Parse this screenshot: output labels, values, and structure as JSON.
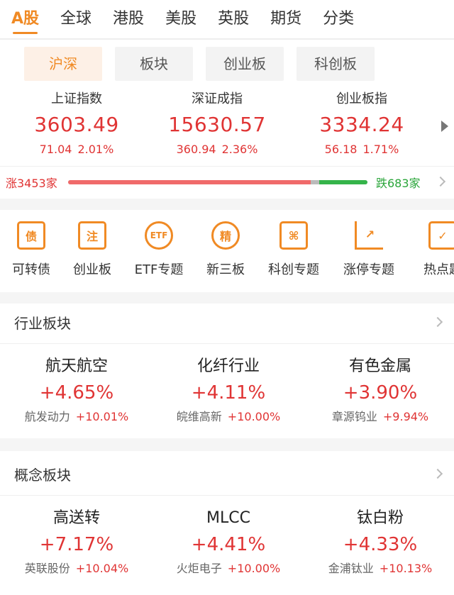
{
  "top_tabs": [
    "A股",
    "全球",
    "港股",
    "美股",
    "英股",
    "期货",
    "分类"
  ],
  "sub_tabs": [
    "沪深",
    "板块",
    "创业板",
    "科创板"
  ],
  "indices": [
    {
      "name": "上证指数",
      "value": "3603.49",
      "change": "71.04",
      "pct": "2.01%"
    },
    {
      "name": "深证成指",
      "value": "15630.57",
      "change": "360.94",
      "pct": "2.36%"
    },
    {
      "name": "创业板指",
      "value": "3334.24",
      "change": "56.18",
      "pct": "1.71%"
    }
  ],
  "breadth": {
    "rise": "涨3453家",
    "fall": "跌683家",
    "rise_fraction": 0.81,
    "fall_fraction": 0.16
  },
  "shortcuts": [
    {
      "label": "可转债",
      "icon": "bond-icon",
      "glyph": "债"
    },
    {
      "label": "创业板",
      "icon": "gem-board-icon",
      "glyph": "注"
    },
    {
      "label": "ETF专题",
      "icon": "etf-icon",
      "glyph": "ETF"
    },
    {
      "label": "新三板",
      "icon": "neeq-icon",
      "glyph": "精"
    },
    {
      "label": "科创专题",
      "icon": "star-market-icon",
      "glyph": "⌘"
    },
    {
      "label": "涨停专题",
      "icon": "limit-up-icon",
      "glyph": "↗"
    },
    {
      "label": "热点题",
      "icon": "hot-topic-icon",
      "glyph": "✓"
    }
  ],
  "industry": {
    "title": "行业板块",
    "items": [
      {
        "name": "航天航空",
        "pct": "+4.65%",
        "leader": "航发动力",
        "leader_pct": "+10.01%"
      },
      {
        "name": "化纤行业",
        "pct": "+4.11%",
        "leader": "皖维高新",
        "leader_pct": "+10.00%"
      },
      {
        "name": "有色金属",
        "pct": "+3.90%",
        "leader": "章源钨业",
        "leader_pct": "+9.94%"
      }
    ]
  },
  "concept": {
    "title": "概念板块",
    "items": [
      {
        "name": "高送转",
        "pct": "+7.17%",
        "leader": "英联股份",
        "leader_pct": "+10.04%"
      },
      {
        "name": "MLCC",
        "pct": "+4.41%",
        "leader": "火炬电子",
        "leader_pct": "+10.00%"
      },
      {
        "name": "钛白粉",
        "pct": "+4.33%",
        "leader": "金浦钛业",
        "leader_pct": "+10.13%"
      }
    ]
  },
  "colors": {
    "accent": "#f08a24",
    "up": "#e03434",
    "down": "#2aa53a"
  }
}
